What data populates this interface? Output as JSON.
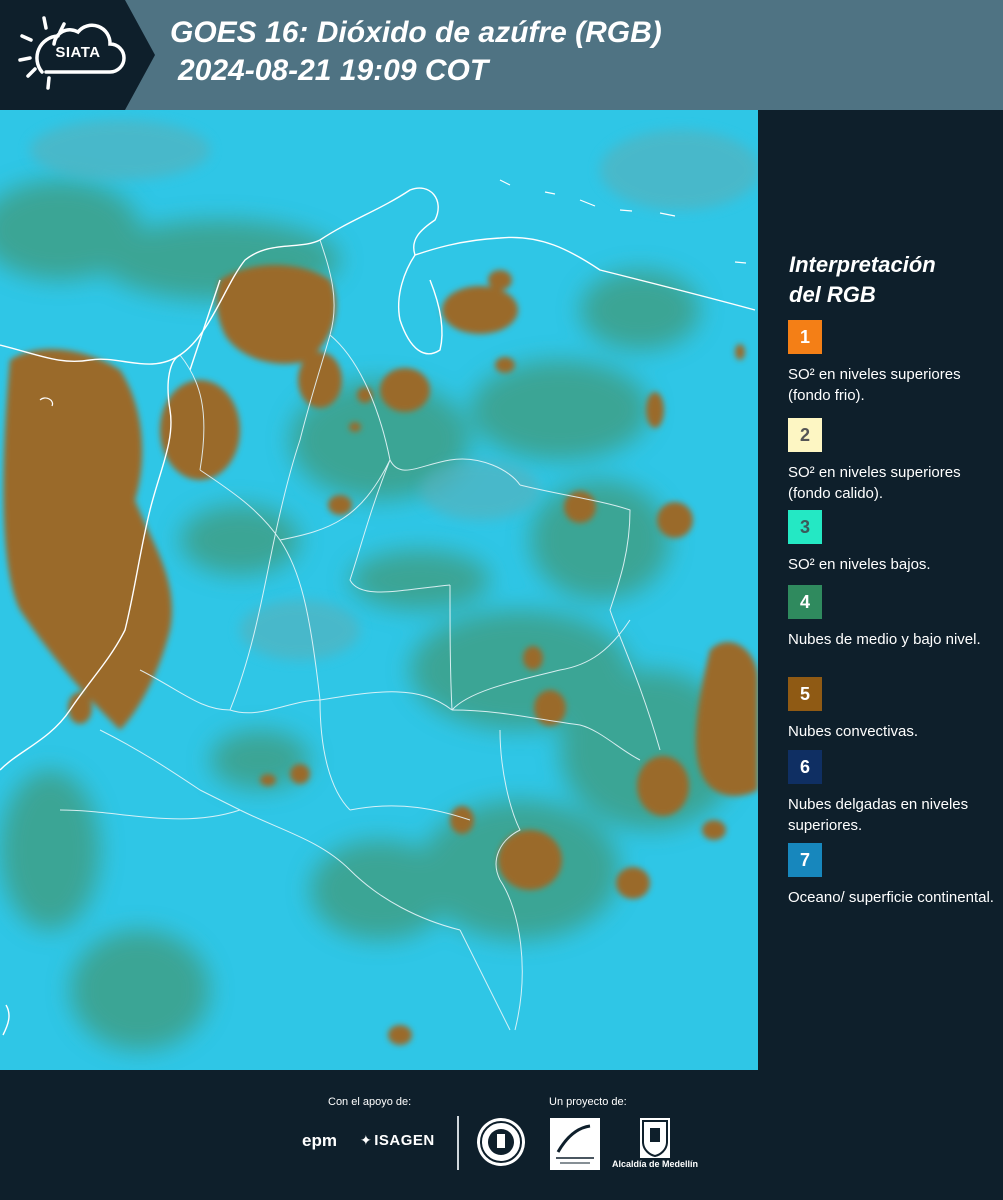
{
  "header": {
    "logo_text": "SIATA",
    "title_line1": "GOES 16: Dióxido de azúfre (RGB)",
    "title_line2": "2024-08-21 19:09 COT"
  },
  "legend": {
    "title_line1": "Interpretación",
    "title_line2": "del RGB",
    "items": [
      {
        "number": "1",
        "label": "SO² en niveles superiores (fondo frio).",
        "color": "#f47f16",
        "text_color": "#ffffff"
      },
      {
        "number": "2",
        "label": "SO² en niveles superiores (fondo calido).",
        "color": "#fdf6c3",
        "text_color": "#555555"
      },
      {
        "number": "3",
        "label": "SO² en niveles bajos.",
        "color": "#24e8c4",
        "text_color": "#3a5a5a"
      },
      {
        "number": "4",
        "label": "Nubes de medio y bajo nivel.",
        "color": "#2f8a5e",
        "text_color": "#ffffff"
      },
      {
        "number": "5",
        "label": "Nubes convectivas.",
        "color": "#8f5a14",
        "text_color": "#ffffff"
      },
      {
        "number": "6",
        "label": "Nubes delgadas en niveles superiores.",
        "color": "#0f2f63",
        "text_color": "#ffffff"
      },
      {
        "number": "7",
        "label": "Oceano/ superficie continental.",
        "color": "#1787bd",
        "text_color": "#ffffff"
      }
    ]
  },
  "footer": {
    "support_label": "Con el apoyo de:",
    "project_label": "Un proyecto de:",
    "sponsor1": "epm",
    "sponsor2": "ISAGEN",
    "alcaldia_label": "Alcaldía de Medellín"
  },
  "colors": {
    "background": "#0e1f2b",
    "header_band": "#4f7383",
    "ocean_cyan": "#2ac4e4",
    "convective_brown": "#9a6b2a",
    "midlevel_green": "#3f9a76"
  }
}
